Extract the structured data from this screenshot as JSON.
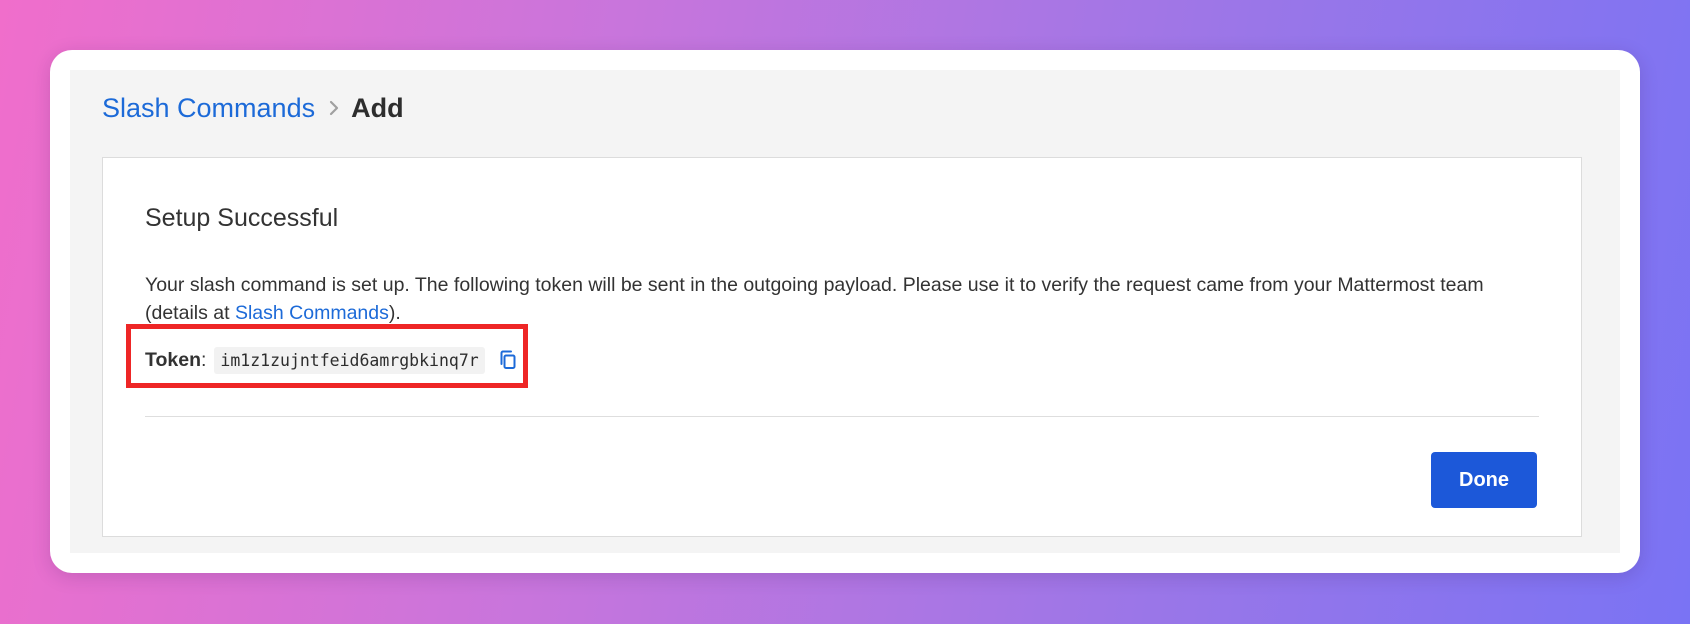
{
  "breadcrumb": {
    "parent": "Slash Commands",
    "current": "Add",
    "separator_icon": "chevron-right-icon"
  },
  "panel": {
    "title": "Setup Successful",
    "description_before": "Your slash command is set up. The following token will be sent in the outgoing payload. Please use it to verify the request came from your Mattermost team (details at ",
    "description_link": "Slash Commands",
    "description_after": ").",
    "token_label": "Token",
    "token_colon": ":",
    "token_value": "im1z1zujntfeid6amrgbkinq7r",
    "copy_icon": "copy-icon",
    "done_label": "Done"
  },
  "colors": {
    "accent": "#1c6ad8",
    "button": "#1c58d9",
    "highlight": "#ee2626"
  }
}
